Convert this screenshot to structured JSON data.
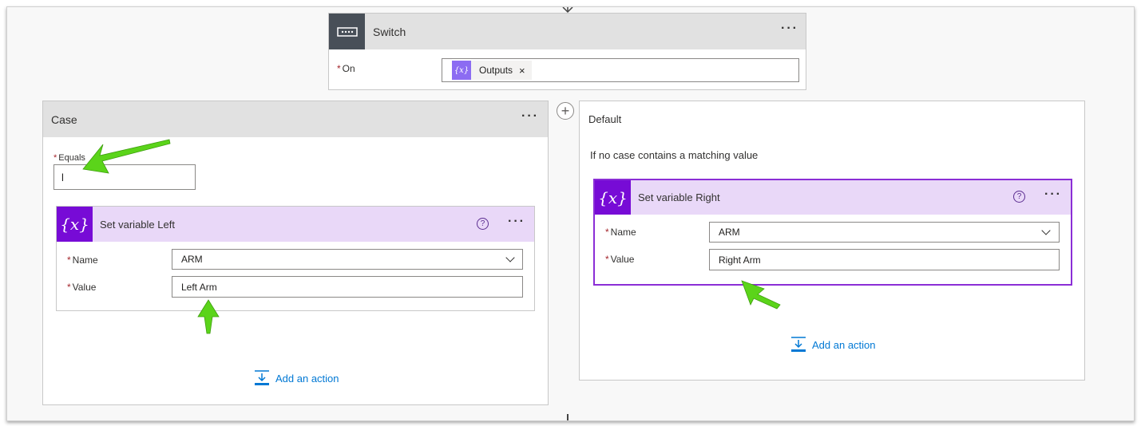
{
  "switch": {
    "title": "Switch",
    "on_label": "On",
    "token_label": "Outputs",
    "token_remove": "×",
    "token_icon": "{x}",
    "menu": "···"
  },
  "case": {
    "title": "Case",
    "menu": "···",
    "equals_label": "Equals",
    "equals_value": "l",
    "action": {
      "title": "Set variable Left",
      "icon": "{x}",
      "help": "?",
      "menu": "···",
      "name_label": "Name",
      "name_value": "ARM",
      "value_label": "Value",
      "value_value": "Left Arm"
    },
    "add_action": "Add an action"
  },
  "default": {
    "title": "Default",
    "description": "If no case contains a matching value",
    "action": {
      "title": "Set variable Right",
      "icon": "{x}",
      "help": "?",
      "menu": "···",
      "name_label": "Name",
      "name_value": "ARM",
      "value_label": "Value",
      "value_value": "Right Arm"
    },
    "add_action": "Add an action"
  },
  "add_case_icon": "+",
  "required_mark": "*",
  "colors": {
    "switch_tile": "#484f58",
    "variable_tile": "#770bd6",
    "variable_header": "#e9d8f8",
    "header_gray": "#e1e1e1",
    "link": "#0078d4",
    "selected_border": "#8b2ed6",
    "annotation_arrow": "#5bd41a"
  }
}
